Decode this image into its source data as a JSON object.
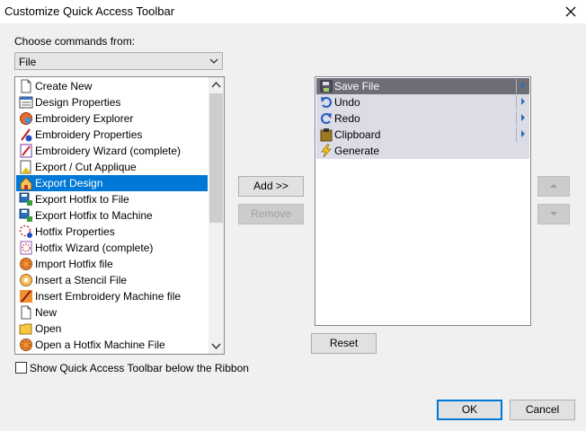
{
  "window": {
    "title": "Customize Quick Access Toolbar"
  },
  "left": {
    "label": "Choose commands from:",
    "dropdown_value": "File",
    "commands": [
      {
        "label": "Create New",
        "icon": "page-icon",
        "selected": false
      },
      {
        "label": "Design Properties",
        "icon": "design-properties-icon",
        "selected": false
      },
      {
        "label": "Embroidery Explorer",
        "icon": "embroidery-explorer-icon",
        "selected": false
      },
      {
        "label": "Embroidery Properties",
        "icon": "embroidery-properties-icon",
        "selected": false
      },
      {
        "label": "Embroidery Wizard (complete)",
        "icon": "wizard-icon",
        "selected": false
      },
      {
        "label": "Export / Cut Applique",
        "icon": "applique-icon",
        "selected": false
      },
      {
        "label": "Export Design",
        "icon": "export-design-icon",
        "selected": true
      },
      {
        "label": "Export Hotfix to File",
        "icon": "floppy-icon",
        "selected": false
      },
      {
        "label": "Export Hotfix to Machine",
        "icon": "floppy-icon",
        "selected": false
      },
      {
        "label": "Hotfix Properties",
        "icon": "hotfix-properties-icon",
        "selected": false
      },
      {
        "label": "Hotfix Wizard (complete)",
        "icon": "hotfix-wizard-icon",
        "selected": false
      },
      {
        "label": "Import Hotfix file",
        "icon": "hotfix-icon",
        "selected": false
      },
      {
        "label": "Insert a Stencil File",
        "icon": "stencil-icon",
        "selected": false
      },
      {
        "label": "Insert Embroidery Machine file",
        "icon": "needle-icon",
        "selected": false
      },
      {
        "label": "New",
        "icon": "page-icon",
        "selected": false
      },
      {
        "label": "Open",
        "icon": "folder-icon",
        "selected": false
      },
      {
        "label": "Open a Hotfix Machine File",
        "icon": "hotfix-icon",
        "selected": false
      }
    ]
  },
  "buttons": {
    "add": "Add >>",
    "remove": "Remove",
    "reset": "Reset",
    "ok": "OK",
    "cancel": "Cancel"
  },
  "qat": {
    "items": [
      {
        "label": "Save File",
        "icon": "save-icon",
        "selected": true,
        "submenu": true
      },
      {
        "label": "Undo",
        "icon": "undo-icon",
        "selected": false,
        "submenu": true
      },
      {
        "label": "Redo",
        "icon": "redo-icon",
        "selected": false,
        "submenu": true
      },
      {
        "label": "Clipboard",
        "icon": "clipboard-icon",
        "selected": false,
        "submenu": true
      },
      {
        "label": "Generate",
        "icon": "lightning-icon",
        "selected": false,
        "submenu": false
      }
    ]
  },
  "checkbox": {
    "label": "Show Quick Access Toolbar below the Ribbon",
    "checked": false
  },
  "colors": {
    "selection": "#0078d7",
    "qat_selection": "#6e6e78",
    "qat_row": "#dcdce6"
  }
}
